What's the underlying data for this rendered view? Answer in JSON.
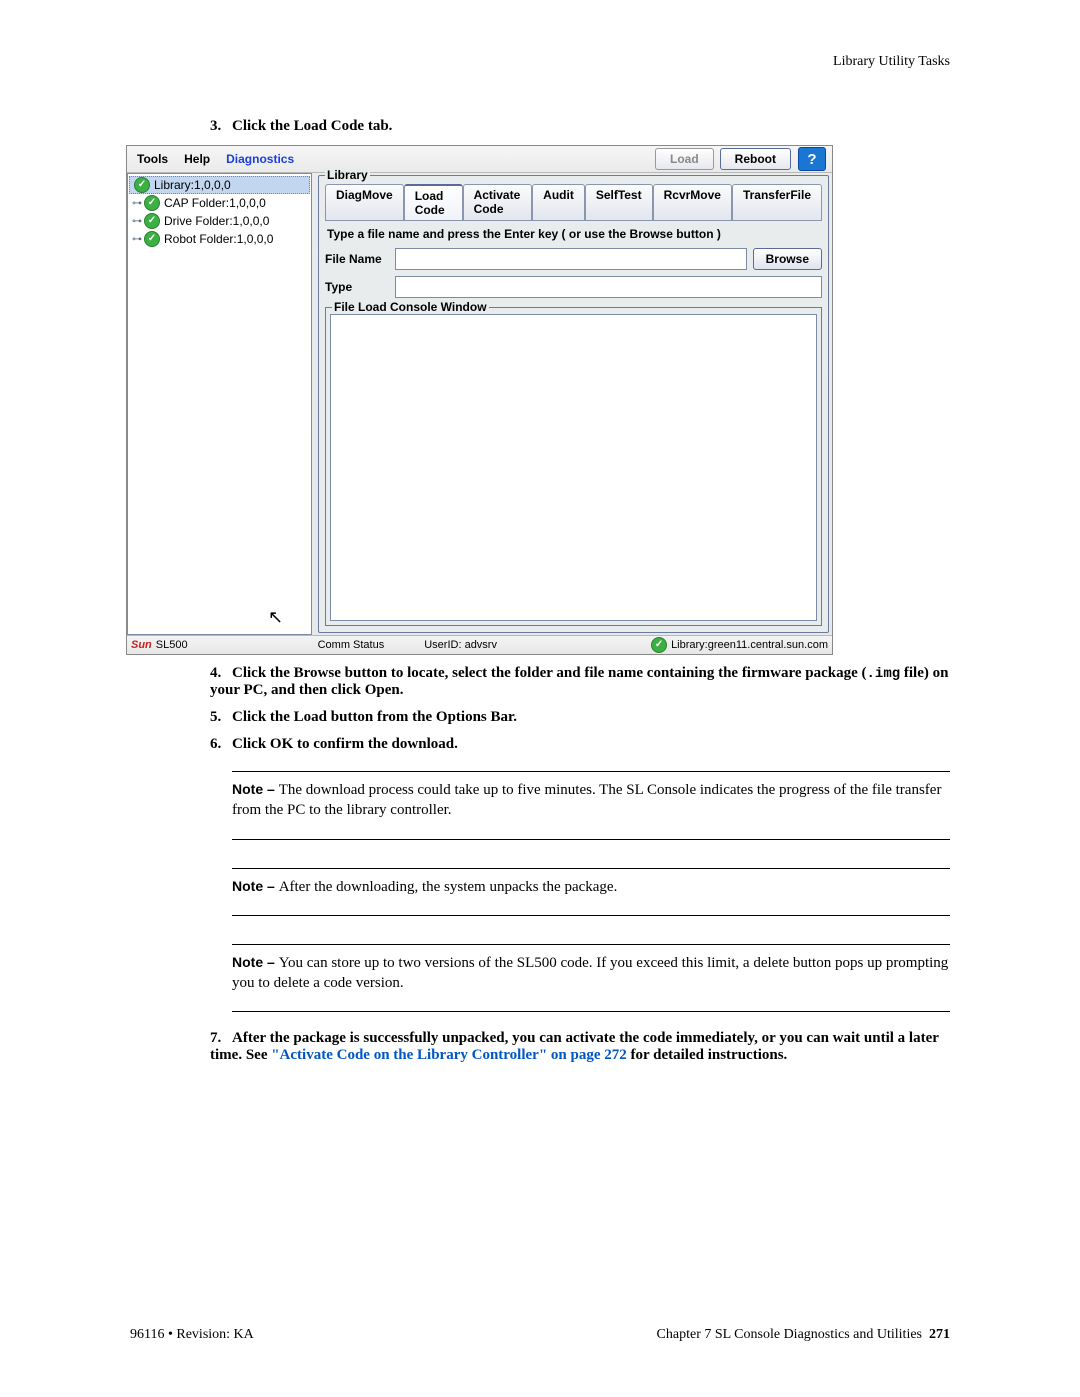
{
  "header": {
    "section": "Library Utility Tasks"
  },
  "step3": {
    "num": "3.",
    "text": "Click the Load Code tab."
  },
  "screenshot": {
    "menu": {
      "tools": "Tools",
      "help": "Help",
      "diagnostics": "Diagnostics"
    },
    "top_buttons": {
      "load": "Load",
      "reboot": "Reboot",
      "help": "?"
    },
    "tree": {
      "root": "Library:1,0,0,0",
      "items": [
        "CAP Folder:1,0,0,0",
        "Drive Folder:1,0,0,0",
        "Robot Folder:1,0,0,0"
      ]
    },
    "fieldset_label": "Library",
    "tabs": [
      "DiagMove",
      "Load Code",
      "Activate Code",
      "Audit",
      "SelfTest",
      "RcvrMove",
      "TransferFile"
    ],
    "active_tab_index": 1,
    "instruction": "Type a file name and press the Enter key ( or use the Browse button )",
    "form": {
      "file_name_label": "File Name",
      "type_label": "Type",
      "browse": "Browse",
      "file_name_value": "",
      "type_value": ""
    },
    "console_label": "File Load Console Window",
    "status": {
      "logo": "Sun",
      "product": "SL500",
      "comm": "Comm Status",
      "user": "UserID: advsrv",
      "library": "Library:green11.central.sun.com"
    }
  },
  "step4": {
    "num": "4.",
    "part1": "Click the Browse button to locate, select the folder and file name containing the firmware package (",
    "code": ".img",
    "part2": " file) on your PC, and then click Open."
  },
  "step5": {
    "num": "5.",
    "text": "Click the Load button from the Options Bar."
  },
  "step6": {
    "num": "6.",
    "text": "Click OK to confirm the download."
  },
  "note1": {
    "label": "Note – ",
    "text": "The download process could take up to five minutes. The SL Console indicates the progress of the file transfer from the PC to the library controller."
  },
  "note2": {
    "label": "Note – ",
    "text": "After the downloading, the system unpacks the package."
  },
  "note3": {
    "label": "Note – ",
    "text": "You can store up to two versions of the SL500 code. If you exceed this limit, a delete button pops up prompting you to delete a code version."
  },
  "step7": {
    "num": "7.",
    "part1": "After the package is successfully unpacked, you can activate the code immediately, or you can wait until a later time. See ",
    "link": "\"Activate Code on the Library Controller\" on page 272",
    "part2": " for detailed instructions."
  },
  "footer": {
    "left": "96116 • Revision: KA",
    "right_chapter": "Chapter 7 SL Console Diagnostics and Utilities",
    "page": "271"
  }
}
